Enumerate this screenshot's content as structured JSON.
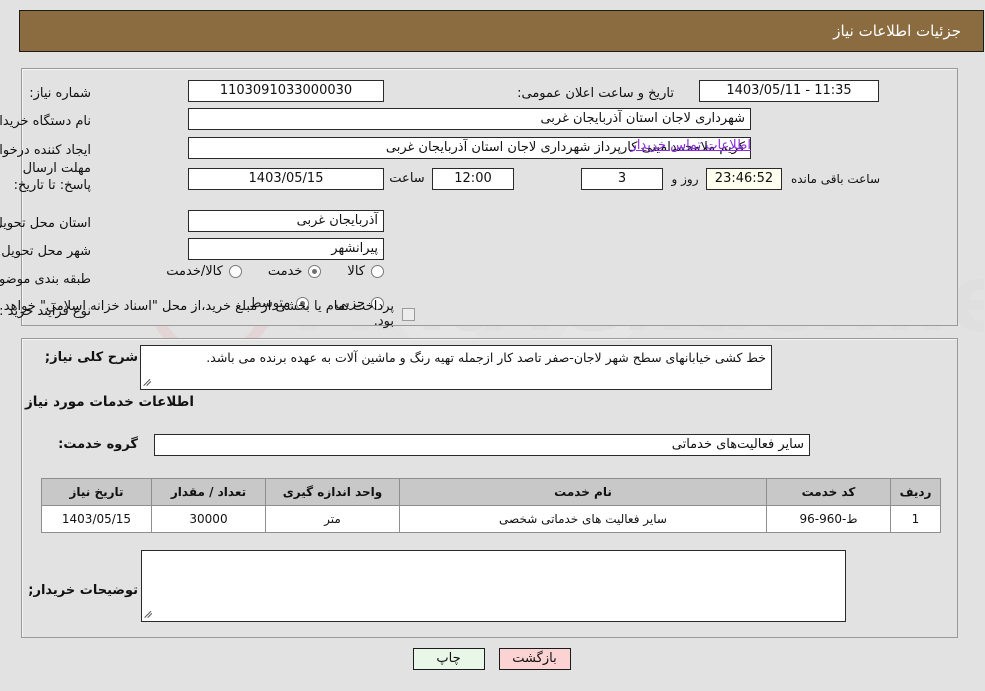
{
  "header": {
    "title": "جزئیات اطلاعات نیاز",
    "bar_color": "#8b6c41"
  },
  "top_form": {
    "need_number_label": "شماره نیاز:",
    "need_number_value": "1103091033000030",
    "announce_label": "تاریخ و ساعت اعلان عمومی:",
    "announce_value": "1403/05/11 - 11:35",
    "org_label": "نام دستگاه خریدار:",
    "org_value": "شهرداری لاجان استان آذربایجان غربی",
    "creator_label": "ایجاد کننده درخواست:",
    "creator_value": "کریم ملامحمدامینی کارپرداز شهرداری لاجان استان آذربایجان غربی",
    "contact_link": "اطلاعات تماس خریدار",
    "deadline_label": "مهلت ارسال پاسخ: تا تاریخ:",
    "deadline_date": "1403/05/15",
    "hour_label": "ساعت",
    "deadline_time": "12:00",
    "days_remaining": "3",
    "day_and_label": "روز و",
    "timer_value": "23:46:52",
    "remaining_label": "ساعت باقی مانده",
    "province_label": "استان محل تحویل:",
    "province_value": "آذربایجان غربی",
    "city_label": "شهر محل تحویل:",
    "city_value": "پیرانشهر",
    "category_label": "طبقه بندی موضوعی:",
    "category_options": [
      {
        "label": "کالا",
        "checked": false
      },
      {
        "label": "خدمت",
        "checked": true
      },
      {
        "label": "کالا/خدمت",
        "checked": false
      }
    ],
    "process_label": "نوع فرآیند خرید :",
    "process_options": [
      {
        "label": "جزیی",
        "checked": false
      },
      {
        "label": "متوسط",
        "checked": true
      }
    ],
    "treasury_checkbox_checked": false,
    "treasury_text": "پرداخت تمام یا بخشی از مبلغ خرید،از محل \"اسناد خزانه اسلامی\" خواهد بود."
  },
  "bottom": {
    "description_label": "شرح کلی نیاز;",
    "description_value": "خط کشی خیابانهای سطح شهر لاجان-صفر تاصد کار ازجمله تهیه رنگ و ماشین آلات به عهده برنده می باشد.",
    "services_info_title": "اطلاعات خدمات مورد نیاز",
    "service_group_label": "گروه خدمت:",
    "service_group_value": "سایر فعالیت‌های خدماتی",
    "table": {
      "columns": [
        "ردیف",
        "کد خدمت",
        "نام خدمت",
        "واحد اندازه گیری",
        "تعداد / مقدار",
        "تاریخ نیاز"
      ],
      "rows": [
        {
          "row_no": "1",
          "service_code": "ط-960-96",
          "service_name": "سایر فعالیت های خدماتی شخصی",
          "unit": "متر",
          "quantity": "30000",
          "need_date": "1403/05/15"
        }
      ]
    },
    "notes_label": "توضیحات خریدار;",
    "notes_value": ""
  },
  "footer": {
    "print_label": "چاپ",
    "back_label": "بازگشت"
  },
  "watermark": {
    "text": "AriaTender.net"
  }
}
